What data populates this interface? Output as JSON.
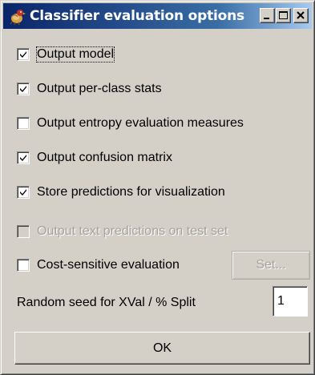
{
  "window": {
    "title": "Classifier evaluation options",
    "title_icon": "weka-bird-icon",
    "controls": {
      "minimize_icon": "minimize-icon",
      "maximize_icon": "maximize-icon",
      "close_icon": "close-icon"
    }
  },
  "options": [
    {
      "label": "Output model",
      "checked": true,
      "enabled": true
    },
    {
      "label": "Output per-class stats",
      "checked": true,
      "enabled": true
    },
    {
      "label": "Output entropy evaluation measures",
      "checked": false,
      "enabled": true
    },
    {
      "label": "Output confusion matrix",
      "checked": true,
      "enabled": true
    },
    {
      "label": "Store predictions for visualization",
      "checked": true,
      "enabled": true
    },
    {
      "label": "Output text predictions on test set",
      "checked": false,
      "enabled": false
    },
    {
      "label": "Cost-sensitive evaluation",
      "checked": false,
      "enabled": true
    }
  ],
  "cost_sensitive": {
    "set_button_label": "Set...",
    "set_button_enabled": false
  },
  "random_seed": {
    "label": "Random seed for XVal / % Split",
    "value": "1"
  },
  "ok_button_label": "OK",
  "colors": {
    "dialog_bg": "#d4d0c8",
    "titlebar_start": "#0a246a",
    "titlebar_end": "#a6caf0",
    "title_text": "#ffffff",
    "disabled_text": "#a6a39c"
  }
}
